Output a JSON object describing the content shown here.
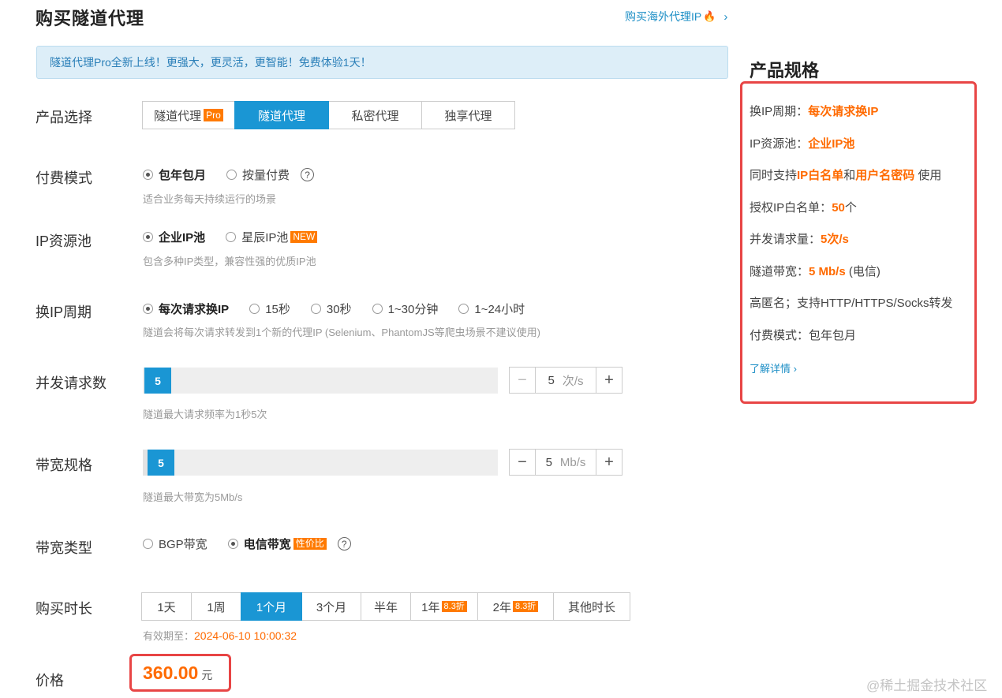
{
  "header": {
    "title": "购买隧道代理",
    "link_text": "购买海外代理IP",
    "link_chevron": "›"
  },
  "banner": {
    "text": "隧道代理Pro全新上线！更强大，更灵活，更智能！免费体验1天！"
  },
  "product": {
    "label": "产品选择",
    "options": [
      {
        "label": "隧道代理",
        "tag": "Pro"
      },
      {
        "label": "隧道代理",
        "active": true
      },
      {
        "label": "私密代理"
      },
      {
        "label": "独享代理"
      }
    ]
  },
  "billing": {
    "label": "付费模式",
    "options": [
      "包年包月",
      "按量付费"
    ],
    "selected": "包年包月",
    "hint": "适合业务每天持续运行的场景"
  },
  "pool": {
    "label": "IP资源池",
    "options": [
      "企业IP池",
      "星辰IP池"
    ],
    "new_tag": "NEW",
    "selected": "企业IP池",
    "hint": "包含多种IP类型，兼容性强的优质IP池"
  },
  "rotation": {
    "label": "换IP周期",
    "options": [
      "每次请求换IP",
      "15秒",
      "30秒",
      "1~30分钟",
      "1~24小时"
    ],
    "selected": "每次请求换IP",
    "hint": "隧道会将每次请求转发到1个新的代理IP (Selenium、PhantomJS等爬虫场景不建议使用)"
  },
  "concurrency": {
    "label": "并发请求数",
    "value": "5",
    "unit": "次/s",
    "minus": "−",
    "plus": "+",
    "hint": "隧道最大请求频率为1秒5次"
  },
  "bandwidth": {
    "label": "带宽规格",
    "value": "5",
    "unit": "Mb/s",
    "minus": "−",
    "plus": "+",
    "hint": "隧道最大带宽为5Mb/s"
  },
  "bw_type": {
    "label": "带宽类型",
    "options": [
      "BGP带宽",
      "电信带宽"
    ],
    "selected": "电信带宽",
    "tag": "性价比"
  },
  "duration": {
    "label": "购买时长",
    "options": [
      {
        "label": "1天"
      },
      {
        "label": "1周"
      },
      {
        "label": "1个月",
        "active": true
      },
      {
        "label": "3个月"
      },
      {
        "label": "半年"
      },
      {
        "label": "1年",
        "tag": "8.3折"
      },
      {
        "label": "2年",
        "tag": "8.3折"
      },
      {
        "label": "其他时长"
      }
    ],
    "valid_label": "有效期至：",
    "valid_date": "2024-06-10 10:00:32"
  },
  "price": {
    "label": "价格",
    "value": "360.00",
    "unit": "元"
  },
  "spec": {
    "title": "产品规格",
    "rotation_label": "换IP周期：",
    "rotation_value": "每次请求换IP",
    "pool_label": "IP资源池：",
    "pool_value": "企业IP池",
    "support_prefix": "同时支持",
    "support_a": "IP白名单",
    "support_and": "和",
    "support_b": "用户名密码",
    "support_suffix": " 使用",
    "whitelist_label": "授权IP白名单：",
    "whitelist_value": "50",
    "whitelist_unit": "个",
    "concurrency_label": "并发请求量：",
    "concurrency_value": "5次/s",
    "bandwidth_label": "隧道带宽：",
    "bandwidth_value": "5 Mb/s",
    "bandwidth_note": " (电信)",
    "anonymity": "高匿名；支持HTTP/HTTPS/Socks转发",
    "billing": "付费模式：包年包月",
    "more": "了解详情 ›"
  },
  "watermark": "@稀土掘金技术社区",
  "colors": {
    "accent": "#1a96d4",
    "highlight": "#ff6a00",
    "annotation": "#e84545"
  }
}
